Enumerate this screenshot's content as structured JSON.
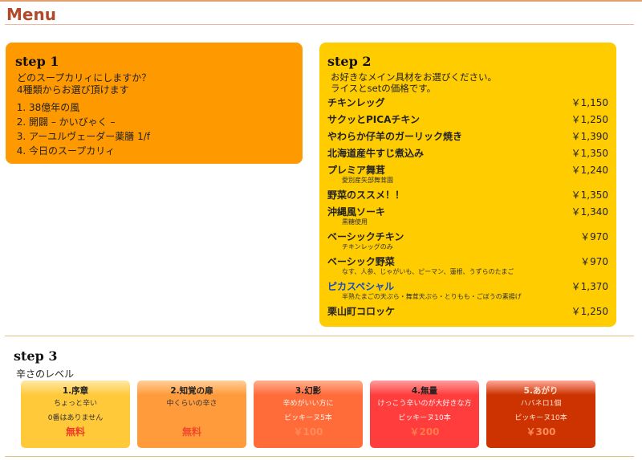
{
  "page": {
    "title": "Menu"
  },
  "step1": {
    "heading": "step 1",
    "desc_line1": "どのスープカリィにしますか？",
    "desc_line2": "4種類からお選び頂けます",
    "options": [
      "38億年の風",
      "開闢 – かいびゃく –",
      "アーユルヴェーダー薬膳 1/f",
      "今日のスープカリィ"
    ]
  },
  "step2": {
    "heading": "step 2",
    "desc_line1": "お好きなメイン具材をお選びください。",
    "desc_line2": "ライスとsetの価格です。",
    "items": [
      {
        "name": "チキンレッグ",
        "price": "￥1,150",
        "sub": ""
      },
      {
        "name": "サクッとPICAチキン",
        "price": "￥1,250",
        "sub": ""
      },
      {
        "name": "やわらか仔羊のガーリック焼き",
        "price": "￥1,390",
        "sub": ""
      },
      {
        "name": "北海道産牛すじ煮込み",
        "price": "￥1,350",
        "sub": ""
      },
      {
        "name": "プレミア舞茸",
        "price": "￥1,240",
        "sub": "愛別産矢部舞茸園"
      },
      {
        "name": "野菜のススメ！！",
        "price": "￥1,350",
        "sub": ""
      },
      {
        "name": "沖縄風ソーキ",
        "price": "￥1,340",
        "sub": "黒糖使用"
      },
      {
        "name": "ベーシックチキン",
        "price": "￥970",
        "sub": "チキンレッグのみ"
      },
      {
        "name": "ベーシック野菜",
        "price": "￥970",
        "sub": "なす、人参、じゃがいも、ピーマン、蓮根、うずらのたまご"
      },
      {
        "name": "ピカスペシャル",
        "price": "￥1,370",
        "sub": "半熟たまごの天ぷら・舞茸天ぷら・とりもも・ごぼうの素揚げ"
      },
      {
        "name": "栗山町コロッケ",
        "price": "￥1,250",
        "sub": ""
      }
    ]
  },
  "step3": {
    "heading": "step 3",
    "sub": "辛さのレベル",
    "levels": [
      {
        "name": "1.序章",
        "line1": "ちょっと辛い",
        "line2": "0番はありません",
        "price": "無料"
      },
      {
        "name": "2.知覚の扉",
        "line1": "中くらいの辛さ",
        "line2": "",
        "price": "無料"
      },
      {
        "name": "3.幻影",
        "line1": "辛めがいい方に",
        "line2": "ピッキーヌ5本",
        "price": "￥100"
      },
      {
        "name": "4.無量",
        "line1": "けっこう辛いのが大好きな方",
        "line2": "ピッキーヌ10本",
        "price": "￥200"
      },
      {
        "name": "5.あがり",
        "line1": "ハバネロ1個",
        "line2": "ピッキーヌ10本",
        "price": "￥300"
      }
    ]
  }
}
